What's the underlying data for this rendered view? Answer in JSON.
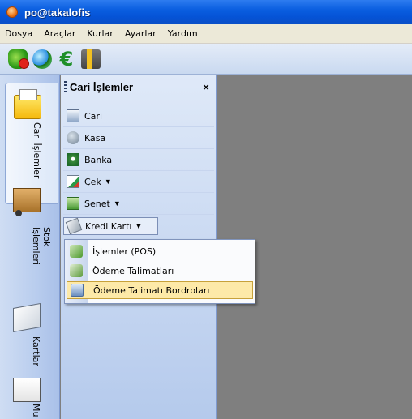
{
  "window": {
    "title": "po@takalofis"
  },
  "menubar": {
    "items": [
      "Dosya",
      "Araçlar",
      "Kurlar",
      "Ayarlar",
      "Yardım"
    ]
  },
  "toolbar": {
    "icons": [
      "shield-tools-icon",
      "globe-icon",
      "euro-icon",
      "tools-icon"
    ]
  },
  "vtabs": [
    {
      "label": "Cari İşlemler",
      "icon": "cari-folder-icon",
      "active": true
    },
    {
      "label": "Stok İşlemleri",
      "icon": "hand-truck-icon",
      "active": false
    },
    {
      "label": "Kartlar",
      "icon": "card-icon",
      "active": false
    },
    {
      "label": "Mu",
      "icon": "accounts-book-icon",
      "active": false
    }
  ],
  "panel": {
    "title": "Cari İşlemler",
    "close": "×",
    "items": [
      {
        "label": "Cari",
        "icon": "cari-icon"
      },
      {
        "label": "Kasa",
        "icon": "kasa-icon"
      },
      {
        "label": "Banka",
        "icon": "banka-icon"
      },
      {
        "label": "Çek",
        "icon": "cek-icon",
        "dropdown": true
      },
      {
        "label": "Senet",
        "icon": "senet-icon",
        "dropdown": true
      },
      {
        "label": "Kredi Kartı",
        "icon": "credit-card-icon",
        "dropdown": true,
        "open": true
      }
    ]
  },
  "submenu": {
    "items": [
      {
        "label": "İşlemler (POS)",
        "icon": "pos-icon",
        "highlighted": false
      },
      {
        "label": "Ödeme Talimatları",
        "icon": "payment-order-icon",
        "highlighted": false
      },
      {
        "label": "Ödeme Talimatı Bordroları",
        "icon": "payroll-icon",
        "highlighted": true
      }
    ]
  },
  "colors": {
    "titlebar": "#0a5ee0",
    "panel": "#c8d8f2",
    "workspace": "#7f7f7f",
    "highlight": "#fde9a8"
  }
}
